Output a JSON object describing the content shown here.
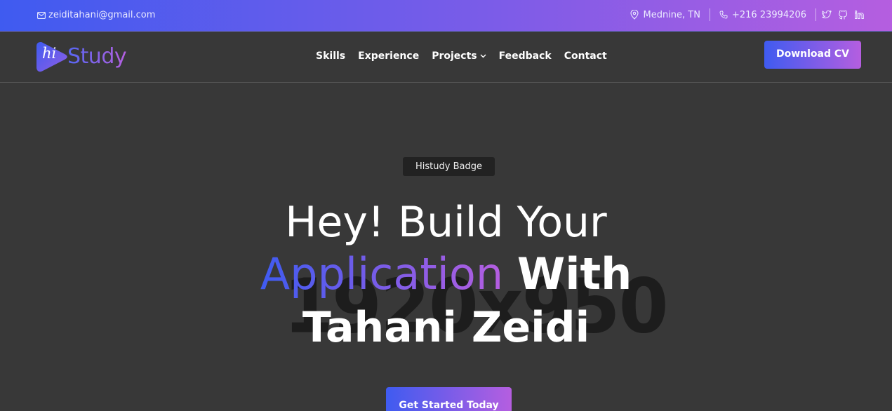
{
  "topbar": {
    "email": "zeiditahani@gmail.com",
    "location": "Mednine, TN",
    "phone": "+216 23994206",
    "social_icons": [
      "twitter-icon",
      "github-icon",
      "linkedin-icon"
    ]
  },
  "brand": {
    "logo_mark": "hi",
    "logo_text": "Study"
  },
  "nav": {
    "items": [
      "Skills",
      "Experience",
      "Projects",
      "Feedback",
      "Contact"
    ],
    "download_cv": "Download CV"
  },
  "hero": {
    "badge": "Histudy Badge",
    "line1": "Hey! Build Your",
    "line2_gradient": "Application",
    "line2_bold": "With",
    "line3": "Tahani Zeidi",
    "cta": "Get Started Today",
    "watermark": "1920x950"
  },
  "colors": {
    "gradient_start": "#3f5bf0",
    "gradient_end": "#b55ee0",
    "background": "#383838"
  }
}
